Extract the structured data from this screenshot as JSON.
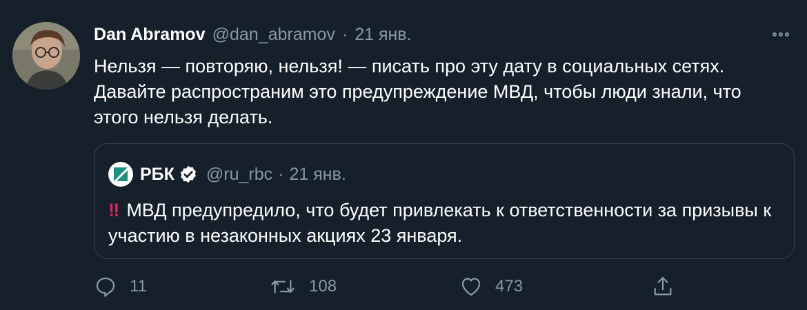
{
  "tweet": {
    "display_name": "Dan Abramov",
    "handle": "@dan_abramov",
    "separator": "·",
    "date": "21 янв.",
    "text": "Нельзя — повторяю, нельзя! — писать про эту дату в социальных сетях. Давайте распространим это предупреждение МВД, чтобы люди знали, что этого нельзя делать."
  },
  "quote": {
    "display_name": "РБК",
    "handle": "@ru_rbc",
    "separator": "·",
    "date": "21 янв.",
    "emoji": "‼",
    "text": "МВД предупредило, что будет привлекать к ответственности за призывы к участию в незаконных акциях 23 января."
  },
  "actions": {
    "replies": "11",
    "retweets": "108",
    "likes": "473"
  },
  "icons": {
    "reply": "reply-icon",
    "retweet": "retweet-icon",
    "like": "heart-icon",
    "share": "share-icon",
    "more": "more-icon",
    "verified": "verified-badge-icon",
    "logo": "rbc-logo"
  },
  "colors": {
    "background": "#15202b",
    "border": "#38444d",
    "secondary_text": "#8899a6",
    "primary_text": "#ffffff",
    "accent_red": "#e0245e"
  }
}
